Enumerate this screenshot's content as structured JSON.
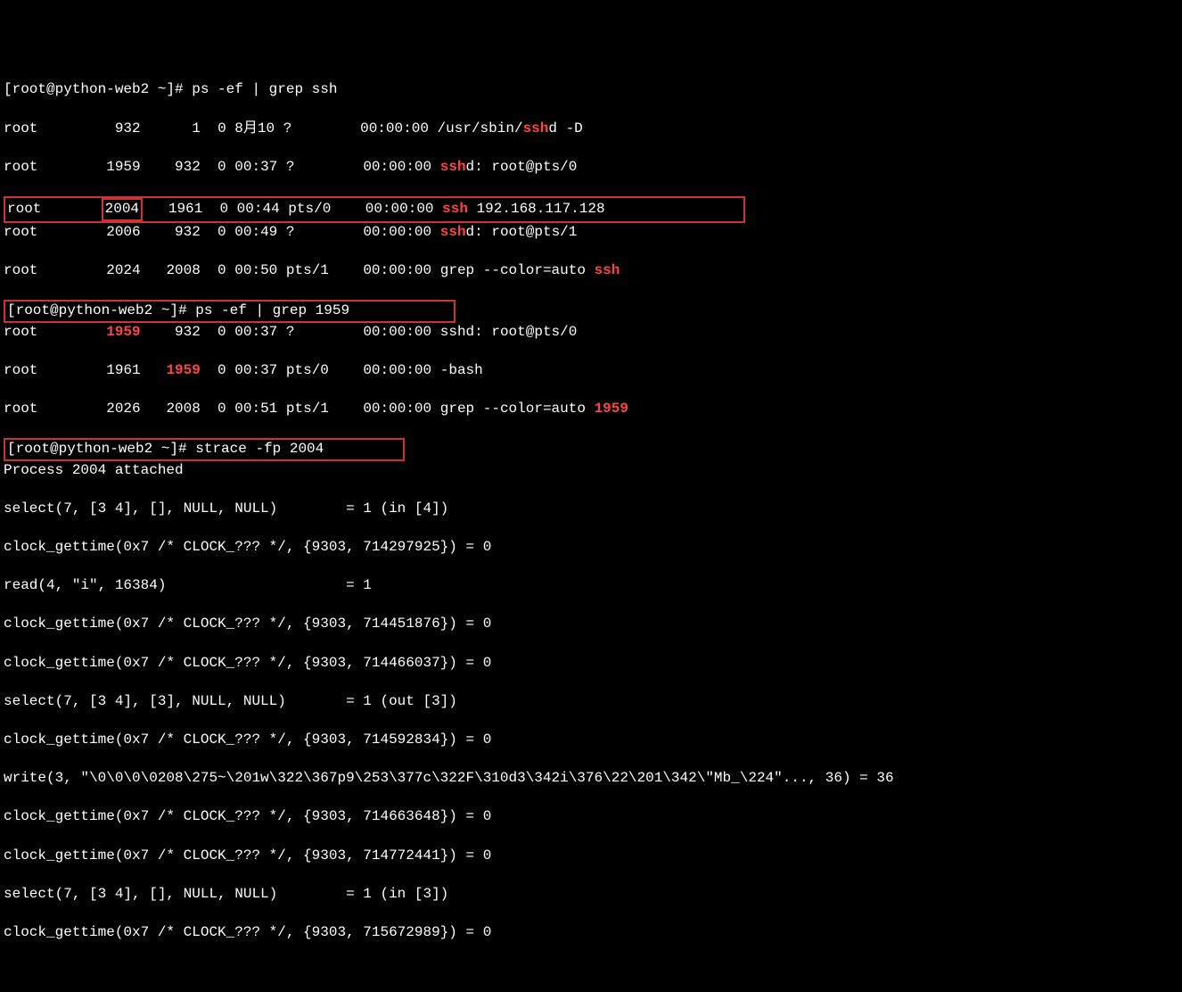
{
  "prompt1": "[root@python-web2 ~]# ",
  "cmd1": "ps -ef | grep ssh",
  "ps1": {
    "r1": {
      "user": "root",
      "pid": "932",
      "ppid": "1",
      "c": "0",
      "stime": "8月10",
      "tty": "?",
      "time": "00:00:00",
      "pre": "/usr/sbin/",
      "hl": "ssh",
      "post": "d -D"
    },
    "r2": {
      "user": "root",
      "pid": "1959",
      "ppid": "932",
      "c": "0",
      "stime": "00:37",
      "tty": "?",
      "time": "00:00:00",
      "pre": "",
      "hl": "ssh",
      "post": "d: root@pts/0"
    },
    "r3": {
      "user": "root",
      "pid": "2004",
      "ppid": "1961",
      "c": "0",
      "stime": "00:44",
      "tty": "pts/0",
      "time": "00:00:00",
      "pre": "",
      "hl": "ssh",
      "post": " 192.168.117.128"
    },
    "r4": {
      "user": "root",
      "pid": "2006",
      "ppid": "932",
      "c": "0",
      "stime": "00:49",
      "tty": "?",
      "time": "00:00:00",
      "pre": "",
      "hl": "ssh",
      "post": "d: root@pts/1"
    },
    "r5": {
      "user": "root",
      "pid": "2024",
      "ppid": "2008",
      "c": "0",
      "stime": "00:50",
      "tty": "pts/1",
      "time": "00:00:00",
      "pre": "grep --color=auto ",
      "hl": "ssh",
      "post": ""
    }
  },
  "cmd2": "ps -ef | grep 1959",
  "ps2": {
    "r1": {
      "user": "root",
      "pid": "1959",
      "ppid": "932",
      "c": "0",
      "stime": "00:37",
      "tty": "?",
      "time": "00:00:00",
      "cmd": "sshd: root@pts/0"
    },
    "r2": {
      "user": "root",
      "pid": "1961",
      "ppid": "1959",
      "c": "0",
      "stime": "00:37",
      "tty": "pts/0",
      "time": "00:00:00",
      "cmd": "-bash"
    },
    "r3": {
      "user": "root",
      "pid": "2026",
      "ppid": "2008",
      "c": "0",
      "stime": "00:51",
      "tty": "pts/1",
      "time": "00:00:00",
      "pre": "grep --color=auto ",
      "hl": "1959",
      "post": ""
    }
  },
  "cmd3": "strace -fp 2004",
  "strace": {
    "l1": "Process 2004 attached",
    "l2": "select(7, [3 4], [], NULL, NULL)        = 1 (in [4])",
    "l3": "clock_gettime(0x7 /* CLOCK_??? */, {9303, 714297925}) = 0",
    "l4": "read(4, \"i\", 16384)                     = 1",
    "l5": "clock_gettime(0x7 /* CLOCK_??? */, {9303, 714451876}) = 0",
    "l6": "clock_gettime(0x7 /* CLOCK_??? */, {9303, 714466037}) = 0",
    "l7": "select(7, [3 4], [3], NULL, NULL)       = 1 (out [3])",
    "l8": "clock_gettime(0x7 /* CLOCK_??? */, {9303, 714592834}) = 0",
    "l9": "write(3, \"\\0\\0\\0\\0208\\275~\\201w\\322\\367p9\\253\\377c\\322F\\310d3\\342i\\376\\22\\201\\342\\\"Mb_\\224\"..., 36) = 36",
    "l10": "clock_gettime(0x7 /* CLOCK_??? */, {9303, 714663648}) = 0",
    "l11": "clock_gettime(0x7 /* CLOCK_??? */, {9303, 714772441}) = 0",
    "l12": "select(7, [3 4], [], NULL, NULL)        = 1 (in [3])",
    "l13": "clock_gettime(0x7 /* CLOCK_??? */, {9303, 715672989}) = 0"
  }
}
